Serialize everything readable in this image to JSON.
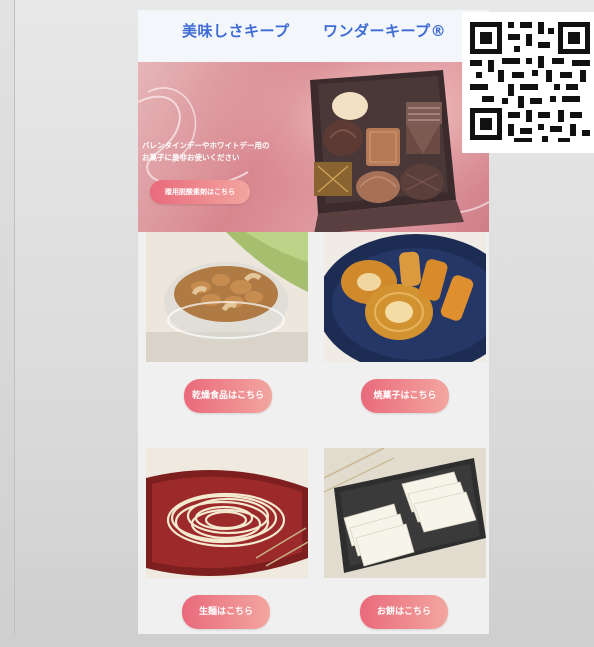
{
  "header": {
    "title_left": "美味しさキープ",
    "title_right": "ワンダーキープ®"
  },
  "hero": {
    "line1": "バレンタインデーやホワイトデー用の",
    "line2": "お菓子に是非お使いください",
    "button": "贈用脱酸素剤はこちら"
  },
  "categories": [
    {
      "button": "乾燥食品はこちら",
      "image": "nuts-bowl"
    },
    {
      "button": "焼菓子はこちら",
      "image": "baked-sweets-plate"
    },
    {
      "button": "生麺はこちら",
      "image": "fresh-noodles-dish"
    },
    {
      "button": "お餅はこちら",
      "image": "mochi-slices-tray"
    }
  ],
  "colors": {
    "title_blue": "#3e6bd6",
    "button_start": "#e96a7b",
    "button_end": "#f3a6a0"
  }
}
